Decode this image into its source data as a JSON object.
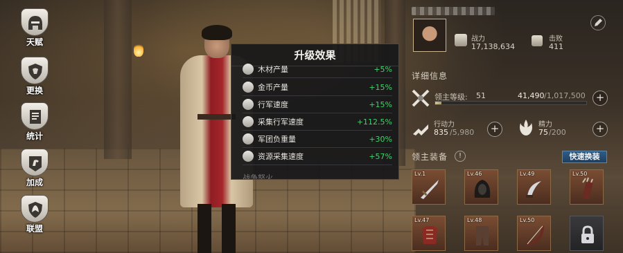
{
  "nav": [
    {
      "label": "天赋",
      "icon": "helmet-icon"
    },
    {
      "label": "更换",
      "icon": "shield-icon"
    },
    {
      "label": "统计",
      "icon": "scroll-icon"
    },
    {
      "label": "加成",
      "icon": "horse-banner-icon"
    },
    {
      "label": "联盟",
      "icon": "dragon-shield-icon"
    }
  ],
  "popup": {
    "title": "升级效果",
    "effects": [
      {
        "name": "木材产量",
        "value": "+5%",
        "icon": "wood-icon"
      },
      {
        "name": "金币产量",
        "value": "+15%",
        "icon": "coin-icon"
      },
      {
        "name": "行军速度",
        "value": "+15%",
        "icon": "boot-icon"
      },
      {
        "name": "采集行军速度",
        "value": "+112.5%",
        "icon": "pickaxe-icon"
      },
      {
        "name": "军团负重量",
        "value": "+30%",
        "icon": "cart-icon"
      },
      {
        "name": "资源采集速度",
        "value": "+57%",
        "icon": "gather-icon"
      }
    ],
    "partial_row": "战争怒火"
  },
  "player": {
    "power_label": "战力",
    "power_value": "17,138,634",
    "defeat_label": "击败",
    "defeat_value": "411"
  },
  "details": {
    "title": "详细信息",
    "lord_level_label": "领主等级:",
    "lord_level": "51",
    "xp_current": "41,490",
    "xp_max": "/1,017,500",
    "xp_fraction": 0.041,
    "action_label": "行动力",
    "action_current": "835",
    "action_max": "/5,980",
    "energy_label": "精力",
    "energy_current": "75",
    "energy_max": "/200"
  },
  "equipment": {
    "title": "领主装备",
    "info_label": "!",
    "swap_label": "快速换装",
    "slots": [
      {
        "level": "Lv.1",
        "icon": "sword-icon"
      },
      {
        "level": "Lv.46",
        "icon": "hood-icon"
      },
      {
        "level": "Lv.49",
        "icon": "dagger-icon"
      },
      {
        "level": "Lv.50",
        "icon": "quiver-icon"
      },
      {
        "level": "Lv.47",
        "icon": "armor-icon"
      },
      {
        "level": "Lv.48",
        "icon": "pants-icon"
      },
      {
        "level": "Lv.50",
        "icon": "bow-icon"
      },
      {
        "level": "",
        "icon": "lock-icon"
      }
    ]
  },
  "colors": {
    "positive": "#3fd46a",
    "swap_button": "#2f5d86"
  }
}
